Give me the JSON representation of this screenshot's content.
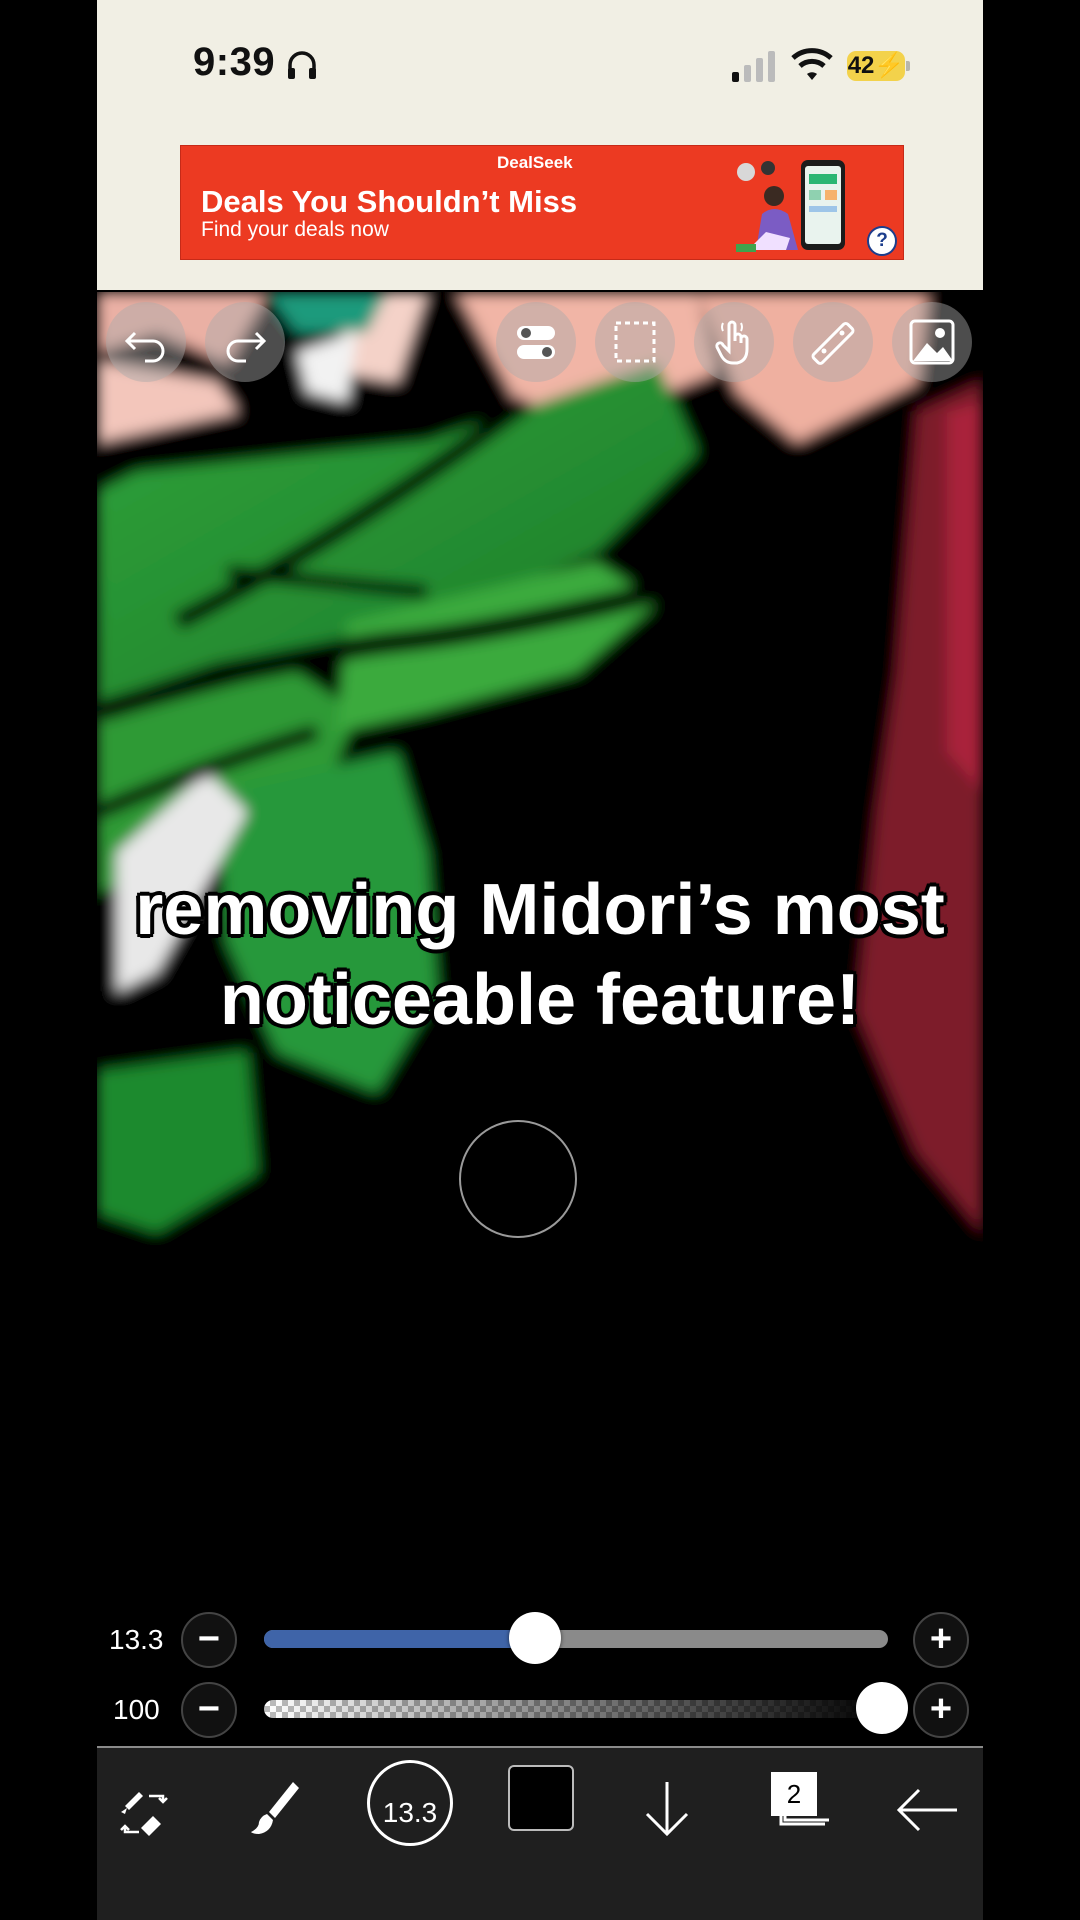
{
  "status_bar": {
    "time": "9:39",
    "battery": "42",
    "icons": [
      "headphones-icon",
      "cellular-signal-icon",
      "wifi-icon",
      "battery-charging-icon"
    ]
  },
  "ad": {
    "brand": "DealSeek",
    "headline": "Deals You Shouldn’t Miss",
    "subline": "Find your deals now",
    "help": "?"
  },
  "top_tools": [
    "undo-icon",
    "redo-icon",
    "toggle-settings-icon",
    "selection-icon",
    "touch-gesture-icon",
    "ruler-icon",
    "image-import-icon"
  ],
  "caption": {
    "line1": "removing Midori’s most",
    "line2": "noticeable feature!"
  },
  "sliders": {
    "brush_size": {
      "value_label": "13.3",
      "fraction": 0.435,
      "minus": "−",
      "plus": "+"
    },
    "opacity": {
      "value_label": "100",
      "fraction": 1.0,
      "minus": "−",
      "plus": "+"
    }
  },
  "toolbar": {
    "brush_size_label": "13.3",
    "layer_count": "2",
    "icons": [
      "tool-switch-icon",
      "brush-icon",
      "brush-size-icon",
      "color-swatch",
      "move-down-icon",
      "layers-icon",
      "back-arrow-icon"
    ]
  },
  "colors": {
    "status_bg": "#f1efe4",
    "ad_red": "#ec3a22",
    "slider_fill": "#3f64a8",
    "toolbar_bg": "#1f1f1f"
  }
}
